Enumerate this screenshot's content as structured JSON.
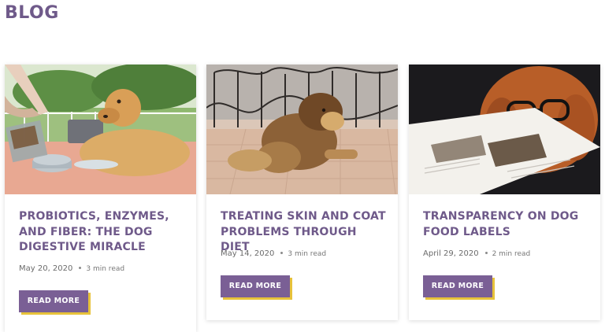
{
  "header": {
    "title": "BLOG"
  },
  "posts": [
    {
      "title": "PROBIOTICS, ENZYMES, AND FIBER: THE DOG DIGESTIVE MIRACLE",
      "date": "May 20, 2020",
      "read_time": "3 min read",
      "button_label": "READ MORE",
      "image": "golden-retriever-food-bowl-photo"
    },
    {
      "title": "TREATING SKIN AND COAT PROBLEMS THROUGH DIET",
      "date": "May 14, 2020",
      "read_time": "3 min read",
      "button_label": "READ MORE",
      "image": "dog-scratching-photo"
    },
    {
      "title": "TRANSPARENCY ON DOG FOOD LABELS",
      "date": "April 29, 2020",
      "read_time": "2 min read",
      "button_label": "READ MORE",
      "image": "dog-with-glasses-reading-photo"
    }
  ],
  "colors": {
    "accent": "#6f5a8a",
    "button": "#7a5f95",
    "button_shadow": "#e7c23a"
  }
}
